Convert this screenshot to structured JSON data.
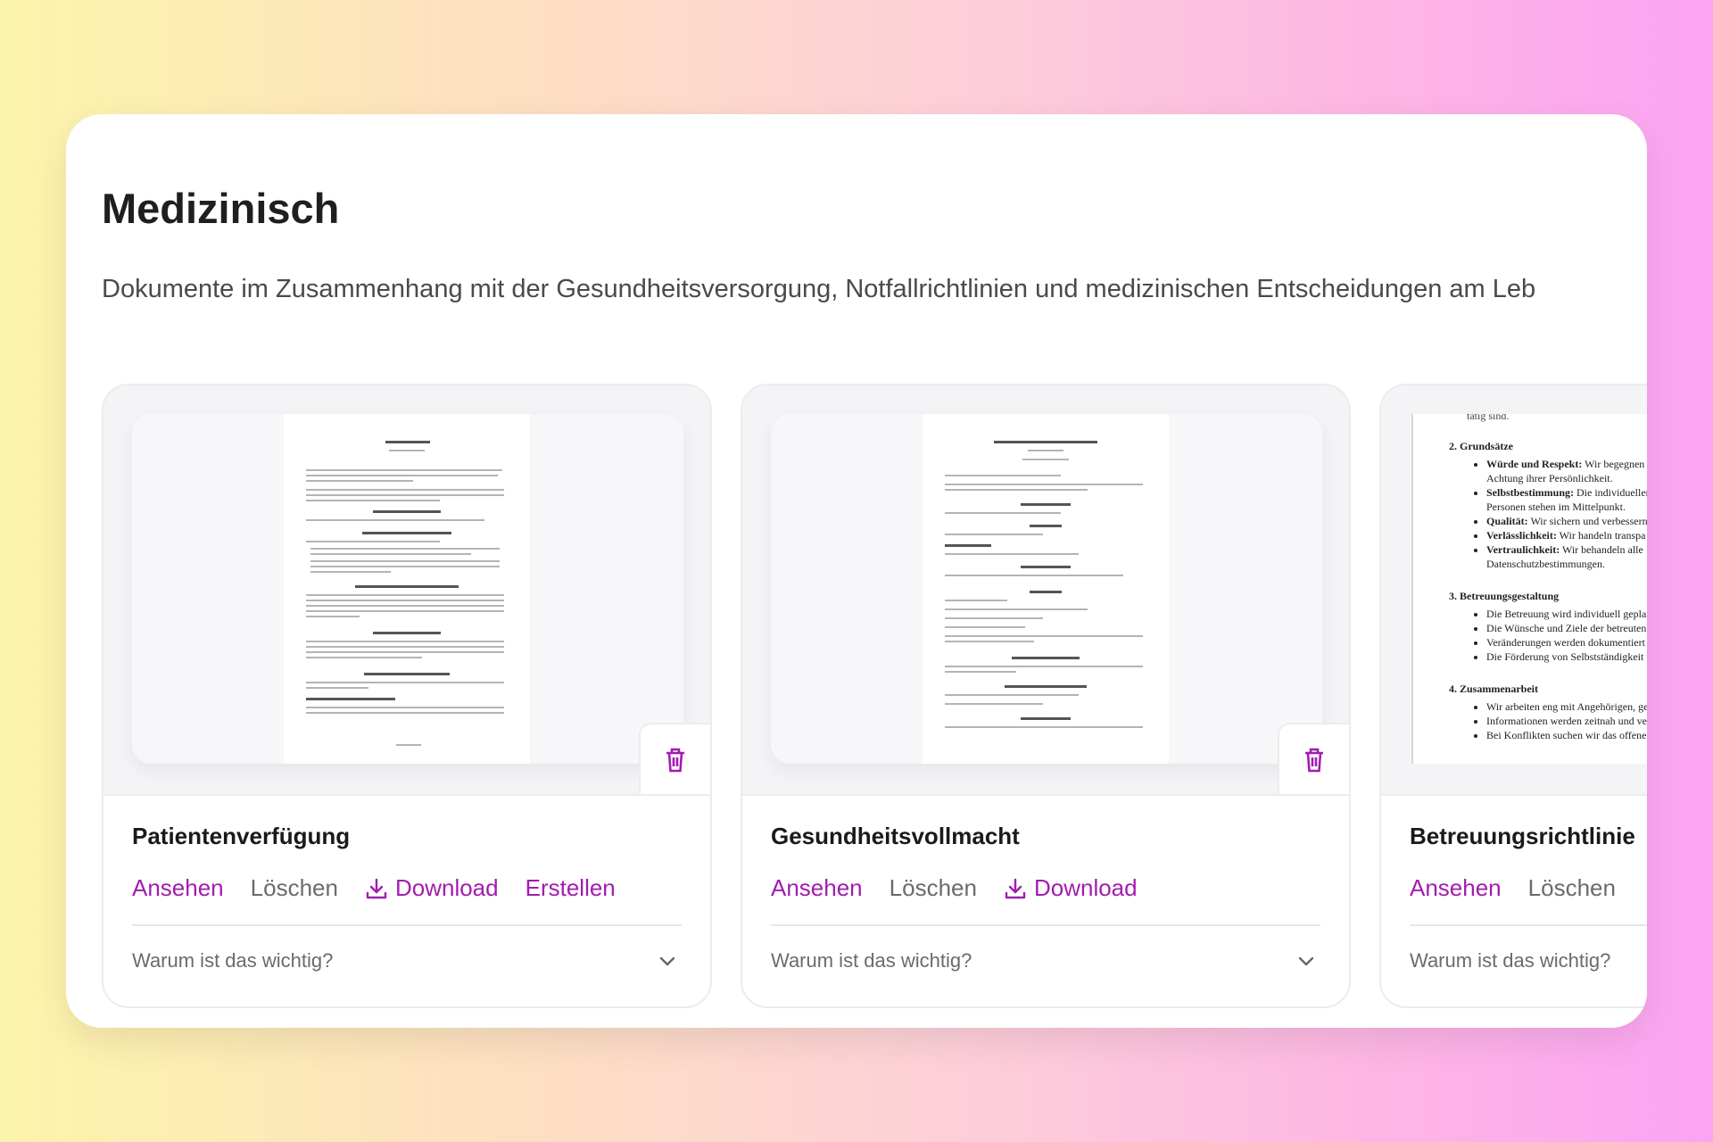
{
  "section": {
    "title": "Medizinisch",
    "description": "Dokumente im Zusammenhang mit der Gesundheitsversorgung, Notfallrichtlinien und medizinischen Entscheidungen am Leb"
  },
  "cards": [
    {
      "title": "Patientenverfügung",
      "actions": {
        "view": "Ansehen",
        "delete": "Löschen",
        "download": "Download",
        "create": "Erstellen"
      },
      "why": "Warum ist das wichtig?"
    },
    {
      "title": "Gesundheitsvollmacht",
      "actions": {
        "view": "Ansehen",
        "delete": "Löschen",
        "download": "Download"
      },
      "why": "Warum ist das wichtig?"
    },
    {
      "title": "Betreuungsrichtlinie",
      "actions": {
        "view": "Ansehen",
        "delete": "Löschen"
      },
      "why": "Warum ist das wichtig?",
      "preview": {
        "top_fragment": "tätig sind.",
        "s2_title": "2.   Grundsätze",
        "s2_items": [
          {
            "bold": "Würde und Respekt:",
            "text": " Wir begegnen a"
          },
          {
            "bold": "",
            "text": "Achtung ihrer Persönlichkeit."
          },
          {
            "bold": "Selbstbestimmung:",
            "text": " Die individuellen"
          },
          {
            "bold": "",
            "text": "Personen stehen im Mittelpunkt."
          },
          {
            "bold": "Qualität:",
            "text": " Wir sichern und verbessern"
          },
          {
            "bold": "Verlässlichkeit:",
            "text": " Wir handeln transpa"
          },
          {
            "bold": "Vertraulichkeit:",
            "text": " Wir behandeln alle"
          },
          {
            "bold": "",
            "text": "Datenschutzbestimmungen."
          }
        ],
        "s3_title": "3.   Betreuungsgestaltung",
        "s3_items": [
          "Die Betreuung wird individuell geplan",
          "Die Wünsche und Ziele der betreuten",
          "Veränderungen werden dokumentiert",
          "Die Förderung von Selbstständigkeit u"
        ],
        "s4_title": "4.   Zusammenarbeit",
        "s4_items": [
          "Wir arbeiten eng mit Angehörigen, ge",
          "Informationen werden zeitnah und ve",
          "Bei Konflikten suchen wir das offene G"
        ]
      }
    }
  ],
  "colors": {
    "accent": "#a21caf",
    "muted": "#6b6b6b"
  },
  "icons": [
    "trash-icon",
    "download-icon",
    "chevron-down-icon"
  ]
}
